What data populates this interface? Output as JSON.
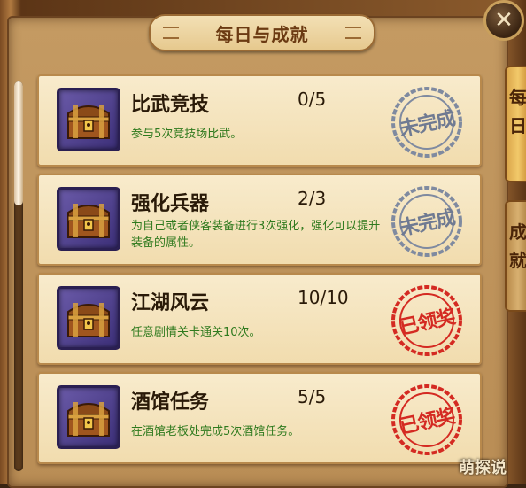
{
  "window": {
    "title": "每日与成就",
    "close_label": "✕"
  },
  "side_tabs": [
    {
      "label": "每日",
      "active": true
    },
    {
      "label": "成就",
      "active": false
    }
  ],
  "tasks": [
    {
      "name": "比武竞技",
      "progress": "0/5",
      "desc": "参与5次竞技场比武。",
      "status": "未完成",
      "state": "incomplete"
    },
    {
      "name": "强化兵器",
      "progress": "2/3",
      "desc": "为自己或者侠客装备进行3次强化，强化可以提升装备的属性。",
      "status": "未完成",
      "state": "incomplete"
    },
    {
      "name": "江湖风云",
      "progress": "10/10",
      "desc": "任意剧情关卡通关10次。",
      "status": "已领奖",
      "state": "claimed"
    },
    {
      "name": "酒馆任务",
      "progress": "5/5",
      "desc": "在酒馆老板处完成5次酒馆任务。",
      "status": "已领奖",
      "state": "claimed"
    }
  ],
  "watermark": "萌探说",
  "colors": {
    "incomplete_stamp": "#7f8aa0",
    "claimed_stamp": "#d42a22",
    "desc_text": "#2f7a1e"
  },
  "icons": {
    "task_icon": "treasure-chest-icon",
    "close": "close-icon"
  }
}
